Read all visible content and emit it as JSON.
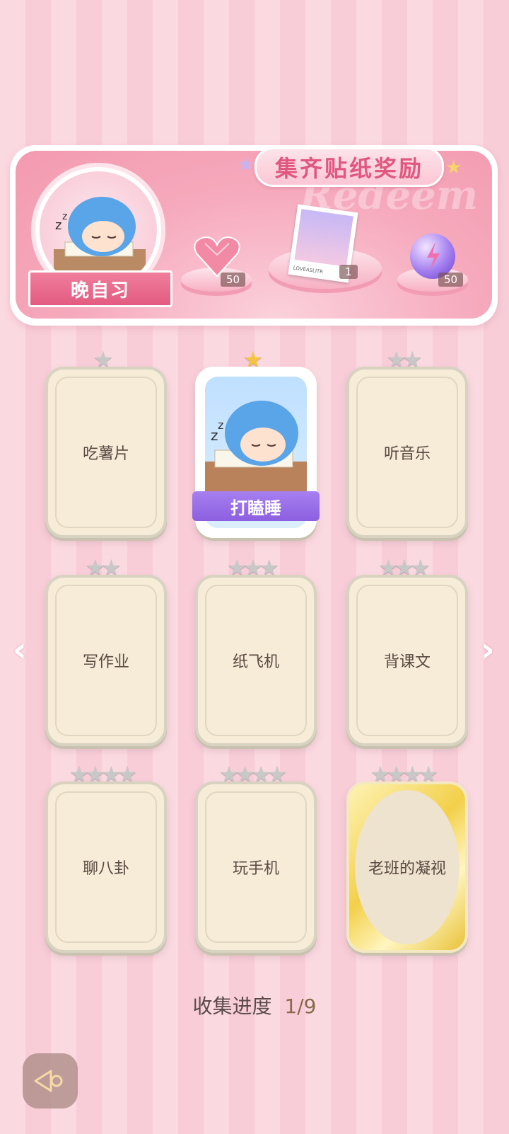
{
  "banner": {
    "title": "集齐贴纸奖励",
    "watermark": "Redeem",
    "character_label": "晚自习",
    "rewards": [
      {
        "icon": "heart-gem-icon",
        "count": "50"
      },
      {
        "icon": "postcard-icon",
        "count": "1",
        "caption": "LOVEASLITR"
      },
      {
        "icon": "energy-orb-icon",
        "count": "50"
      }
    ]
  },
  "cards": [
    {
      "label": "吃薯片",
      "stars": 1,
      "state": "locked"
    },
    {
      "label": "打瞌睡",
      "stars": 1,
      "state": "unlocked"
    },
    {
      "label": "听音乐",
      "stars": 2,
      "state": "locked"
    },
    {
      "label": "写作业",
      "stars": 2,
      "state": "locked"
    },
    {
      "label": "纸飞机",
      "stars": 3,
      "state": "locked"
    },
    {
      "label": "背课文",
      "stars": 3,
      "state": "locked"
    },
    {
      "label": "聊八卦",
      "stars": 4,
      "state": "locked"
    },
    {
      "label": "玩手机",
      "stars": 4,
      "state": "locked"
    },
    {
      "label": "老班的凝视",
      "stars": 4,
      "state": "gold"
    }
  ],
  "progress": {
    "label": "收集进度",
    "value": "1/9"
  },
  "nav": {
    "prev": "‹",
    "next": "›"
  },
  "colors": {
    "accent_pink": "#e25b80",
    "name_tag_purple": "#8c5fe0",
    "star_gold": "#f5c542",
    "star_silver": "#c8c8c8"
  }
}
